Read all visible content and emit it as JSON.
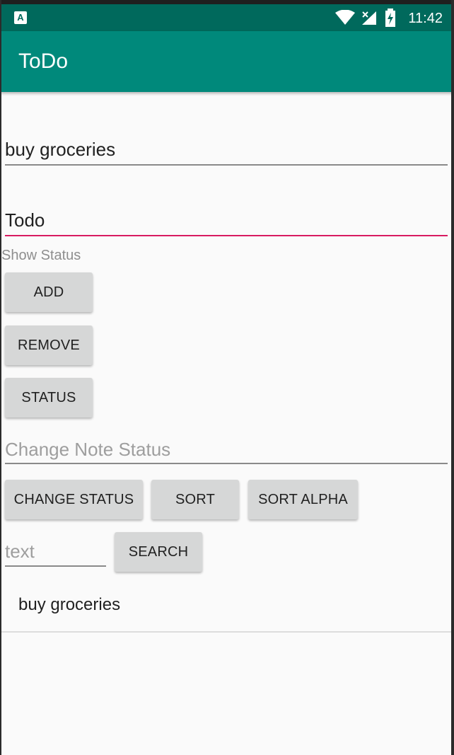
{
  "status_bar": {
    "time": "11:42",
    "notification_badge": "A",
    "icons": [
      "wifi-icon",
      "signal-icon",
      "battery-charging-icon"
    ]
  },
  "app_bar": {
    "title": "ToDo"
  },
  "inputs": {
    "note_text": {
      "value": "buy groceries"
    },
    "todo_field": {
      "value": "Todo"
    },
    "change_status_field": {
      "placeholder": "Change Note Status"
    },
    "search_field": {
      "placeholder": "text"
    }
  },
  "labels": {
    "show_status": "Show Status"
  },
  "buttons": {
    "add": "ADD",
    "remove": "REMOVE",
    "status": "STATUS",
    "change_status": "CHANGE STATUS",
    "sort": "SORT",
    "sort_alpha": "SORT ALPHA",
    "search": "SEARCH"
  },
  "list": {
    "items": [
      "buy groceries"
    ]
  },
  "colors": {
    "status_bar": "#00695c",
    "app_bar": "#00897b",
    "accent": "#d81b60",
    "button": "#d6d7d7"
  }
}
